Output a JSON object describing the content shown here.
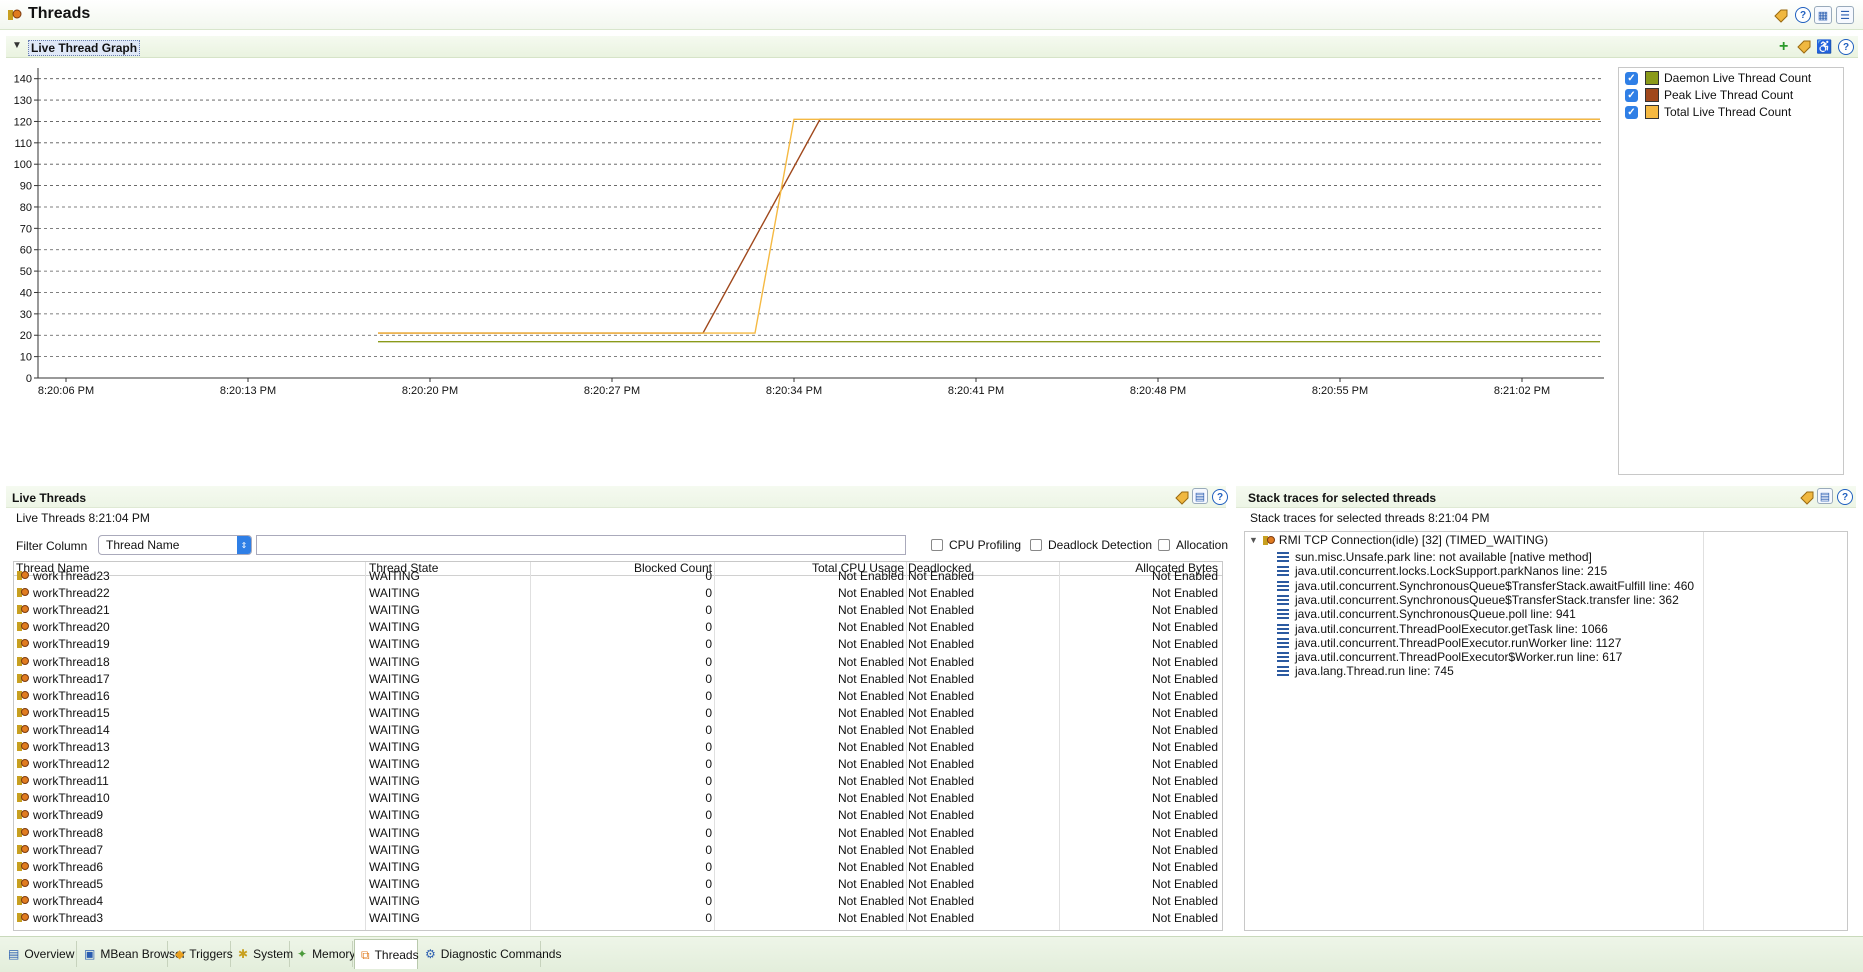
{
  "window": {
    "title": "Threads"
  },
  "graph": {
    "section_label": "Live Thread Graph"
  },
  "chart_data": {
    "type": "line",
    "x": [
      "8:20:06 PM",
      "8:20:13 PM",
      "8:20:20 PM",
      "8:20:27 PM",
      "8:20:34 PM",
      "8:20:41 PM",
      "8:20:48 PM",
      "8:20:55 PM",
      "8:21:02 PM"
    ],
    "ylim": [
      0,
      145
    ],
    "yticks": [
      0,
      10,
      20,
      30,
      40,
      50,
      60,
      70,
      80,
      90,
      100,
      110,
      120,
      130,
      140
    ],
    "grid": true,
    "legend_position": "right",
    "series": [
      {
        "name": "Daemon Live Thread Count",
        "color": "#8a9a1a",
        "points": [
          [
            "8:20:18 PM",
            17
          ],
          [
            "8:21:05 PM",
            17
          ]
        ]
      },
      {
        "name": "Peak Live Thread Count",
        "color": "#a0481c",
        "points": [
          [
            "8:20:18 PM",
            21
          ],
          [
            "8:20:30.5 PM",
            21
          ],
          [
            "8:20:35 PM",
            121
          ],
          [
            "8:21:05 PM",
            121
          ]
        ]
      },
      {
        "name": "Total Live Thread Count",
        "color": "#f5b942",
        "points": [
          [
            "8:20:18 PM",
            21
          ],
          [
            "8:20:32.5 PM",
            21
          ],
          [
            "8:20:34 PM",
            121
          ],
          [
            "8:21:05 PM",
            121
          ]
        ]
      }
    ]
  },
  "live_threads": {
    "title": "Live Threads",
    "timestamp": "Live Threads 8:21:04 PM",
    "filter_label": "Filter Column",
    "filter_value": "Thread Name",
    "filter_text": "",
    "options": [
      "CPU Profiling",
      "Deadlock Detection",
      "Allocation"
    ],
    "columns": [
      "Thread Name",
      "Thread State",
      "Blocked Count",
      "Total CPU Usage",
      "Deadlocked",
      "Allocated Bytes"
    ],
    "rows": [
      [
        "workThread23",
        "WAITING",
        "0",
        "Not Enabled",
        "Not Enabled",
        "Not Enabled"
      ],
      [
        "workThread22",
        "WAITING",
        "0",
        "Not Enabled",
        "Not Enabled",
        "Not Enabled"
      ],
      [
        "workThread21",
        "WAITING",
        "0",
        "Not Enabled",
        "Not Enabled",
        "Not Enabled"
      ],
      [
        "workThread20",
        "WAITING",
        "0",
        "Not Enabled",
        "Not Enabled",
        "Not Enabled"
      ],
      [
        "workThread19",
        "WAITING",
        "0",
        "Not Enabled",
        "Not Enabled",
        "Not Enabled"
      ],
      [
        "workThread18",
        "WAITING",
        "0",
        "Not Enabled",
        "Not Enabled",
        "Not Enabled"
      ],
      [
        "workThread17",
        "WAITING",
        "0",
        "Not Enabled",
        "Not Enabled",
        "Not Enabled"
      ],
      [
        "workThread16",
        "WAITING",
        "0",
        "Not Enabled",
        "Not Enabled",
        "Not Enabled"
      ],
      [
        "workThread15",
        "WAITING",
        "0",
        "Not Enabled",
        "Not Enabled",
        "Not Enabled"
      ],
      [
        "workThread14",
        "WAITING",
        "0",
        "Not Enabled",
        "Not Enabled",
        "Not Enabled"
      ],
      [
        "workThread13",
        "WAITING",
        "0",
        "Not Enabled",
        "Not Enabled",
        "Not Enabled"
      ],
      [
        "workThread12",
        "WAITING",
        "0",
        "Not Enabled",
        "Not Enabled",
        "Not Enabled"
      ],
      [
        "workThread11",
        "WAITING",
        "0",
        "Not Enabled",
        "Not Enabled",
        "Not Enabled"
      ],
      [
        "workThread10",
        "WAITING",
        "0",
        "Not Enabled",
        "Not Enabled",
        "Not Enabled"
      ],
      [
        "workThread9",
        "WAITING",
        "0",
        "Not Enabled",
        "Not Enabled",
        "Not Enabled"
      ],
      [
        "workThread8",
        "WAITING",
        "0",
        "Not Enabled",
        "Not Enabled",
        "Not Enabled"
      ],
      [
        "workThread7",
        "WAITING",
        "0",
        "Not Enabled",
        "Not Enabled",
        "Not Enabled"
      ],
      [
        "workThread6",
        "WAITING",
        "0",
        "Not Enabled",
        "Not Enabled",
        "Not Enabled"
      ],
      [
        "workThread5",
        "WAITING",
        "0",
        "Not Enabled",
        "Not Enabled",
        "Not Enabled"
      ],
      [
        "workThread4",
        "WAITING",
        "0",
        "Not Enabled",
        "Not Enabled",
        "Not Enabled"
      ],
      [
        "workThread3",
        "WAITING",
        "0",
        "Not Enabled",
        "Not Enabled",
        "Not Enabled"
      ]
    ]
  },
  "stack_traces": {
    "title": "Stack traces for selected threads",
    "timestamp": "Stack traces for selected threads 8:21:04 PM",
    "thread": "RMI TCP Connection(idle) [32] (TIMED_WAITING)",
    "frames": [
      "sun.misc.Unsafe.park line: not available [native method]",
      "java.util.concurrent.locks.LockSupport.parkNanos line: 215",
      "java.util.concurrent.SynchronousQueue$TransferStack.awaitFulfill line: 460",
      "java.util.concurrent.SynchronousQueue$TransferStack.transfer line: 362",
      "java.util.concurrent.SynchronousQueue.poll line: 941",
      "java.util.concurrent.ThreadPoolExecutor.getTask line: 1066",
      "java.util.concurrent.ThreadPoolExecutor.runWorker line: 1127",
      "java.util.concurrent.ThreadPoolExecutor$Worker.run line: 617",
      "java.lang.Thread.run line: 745"
    ]
  },
  "tabs": [
    {
      "label": "Overview",
      "icon": "overview-icon",
      "active": false
    },
    {
      "label": "MBean Browser",
      "icon": "mbean-icon",
      "active": false
    },
    {
      "label": "Triggers",
      "icon": "triggers-icon",
      "active": false
    },
    {
      "label": "System",
      "icon": "system-icon",
      "active": false
    },
    {
      "label": "Memory",
      "icon": "memory-icon",
      "active": false
    },
    {
      "label": "Threads",
      "icon": "threads-icon",
      "active": true
    },
    {
      "label": "Diagnostic Commands",
      "icon": "diagnostic-icon",
      "active": false
    }
  ]
}
